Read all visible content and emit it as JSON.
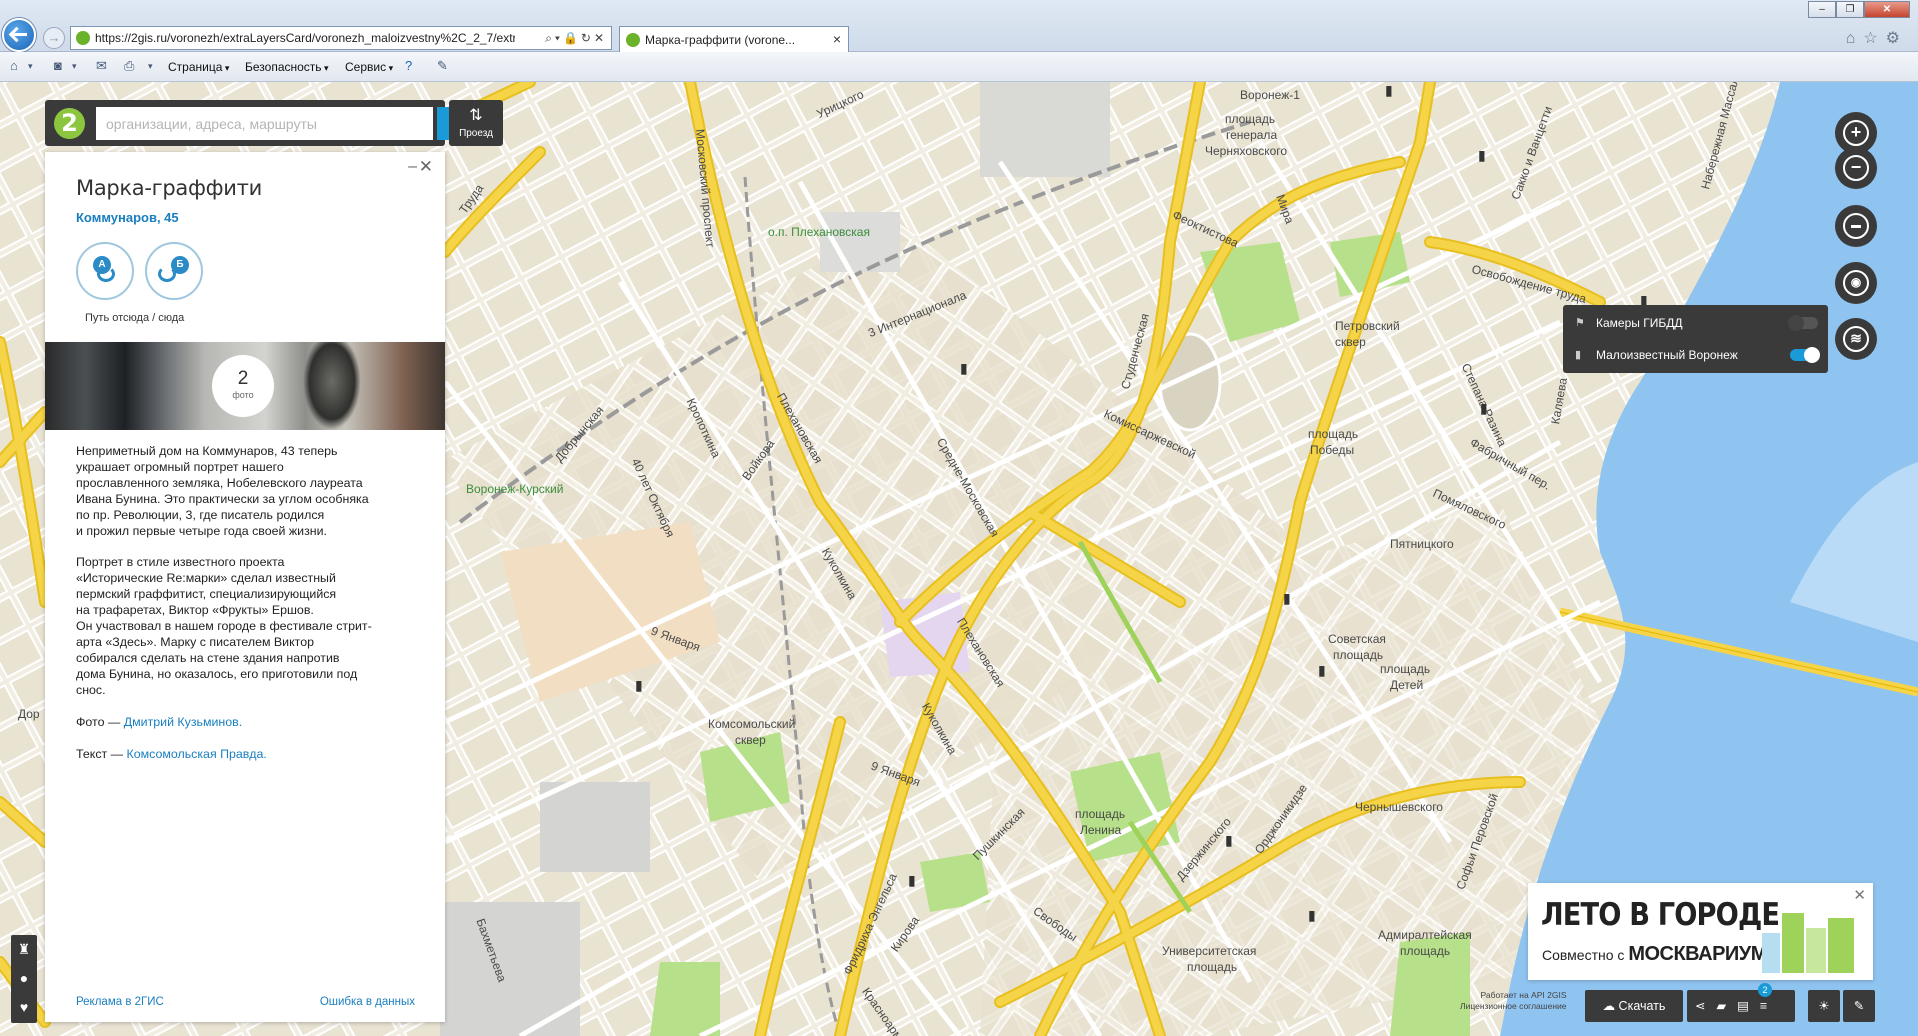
{
  "browser": {
    "url": "https://2gis.ru/voronezh/extraLayersCard/voronezh_maloizvestny%2C_2_7/extraLayer",
    "tab_title": "Марка-граффити (vorone...",
    "toolbar": {
      "page_label": "Страница",
      "security_label": "Безопасность",
      "service_label": "Сервис"
    }
  },
  "search": {
    "placeholder": "организации, адреса, маршруты",
    "route_label": "Проезд"
  },
  "card": {
    "title": "Марка-граффити",
    "address": "Коммунаров, 45",
    "route_from_letter": "А",
    "route_to_letter": "Б",
    "route_caption": "Путь отсюда / сюда",
    "photo_count": "2",
    "photo_count_label": "фото",
    "paragraph_1": "Неприметный дом на Коммунаров, 43 теперь\nукрашает огромный портрет нашего\nпрославленного земляка, Нобелевского лауреата\nИвана Бунина. Это практически за углом особняка\nпо пр. Революции, 3, где писатель родился\nи прожил первые четыре года своей жизни.",
    "paragraph_2": "Портрет в стиле известного проекта\n«Исторические Re:марки» сделал известный\nпермский граффитист, специализирующийся\nна трафаретах, Виктор «Фрукты» Ершов.\nОн участвовал в нашем городе в фестивале стрит-\nарта «Здесь». Марку с писателем Виктор\nсобирался сделать на стене здания напротив\nдома Бунина, но оказалось, его приготовили под\nснос.",
    "photo_credit_prefix": "Фото — ",
    "photo_credit_link": "Дмитрий Кузьминов.",
    "text_credit_prefix": "Текст — ",
    "text_credit_link": "Комсомольская Правда.",
    "footer_ad": "Реклама в 2ГИС",
    "footer_error": "Ошибка в данных"
  },
  "layers": {
    "items": [
      {
        "label": "Камеры ГИБДД",
        "on": false
      },
      {
        "label": "Малоизвестный Воронеж",
        "on": true
      }
    ]
  },
  "promo": {
    "title": "ЛЕТО В ГОРОДЕ",
    "subtitle_prefix": "Совместно с",
    "brand": "МОСКВАРИУМ"
  },
  "bottom": {
    "download_label": "Скачать",
    "credit_line1": "Работает на API 2GIS",
    "credit_line2": "Лицензионное соглашение",
    "badge": "2"
  },
  "map_labels": [
    {
      "text": "Урицкого"
    },
    {
      "text": "Московский проспект"
    },
    {
      "text": "Воронеж-1"
    },
    {
      "text": "площадь"
    },
    {
      "text": "генерала"
    },
    {
      "text": "Черняховского"
    },
    {
      "text": "о.п. Плехановская"
    },
    {
      "text": "Феоктистова"
    },
    {
      "text": "Мира"
    },
    {
      "text": "Освобождение труда"
    },
    {
      "text": "Петровский"
    },
    {
      "text": "сквер"
    },
    {
      "text": "3 Интернационала"
    },
    {
      "text": "Студенческая"
    },
    {
      "text": "Комиссаржевской"
    },
    {
      "text": "Добрынская"
    },
    {
      "text": "Кропоткина"
    },
    {
      "text": "Плехановская"
    },
    {
      "text": "Воронеж-Курский"
    },
    {
      "text": "40 лет Октября"
    },
    {
      "text": "Войкова"
    },
    {
      "text": "Средне-Московская"
    },
    {
      "text": "площадь"
    },
    {
      "text": "Победы"
    },
    {
      "text": "Фабричный пер."
    },
    {
      "text": "Помяловского"
    },
    {
      "text": "Пятницкого"
    },
    {
      "text": "Куколкина"
    },
    {
      "text": "9 Января"
    },
    {
      "text": "Плехановская"
    },
    {
      "text": "Советская"
    },
    {
      "text": "площадь"
    },
    {
      "text": "площадь"
    },
    {
      "text": "Детей"
    },
    {
      "text": "Комсомольский"
    },
    {
      "text": "сквер"
    },
    {
      "text": "9 Января"
    },
    {
      "text": "Куколкина"
    },
    {
      "text": "Пушкинская"
    },
    {
      "text": "Чернышевского"
    },
    {
      "text": "площадь"
    },
    {
      "text": "Ленина"
    },
    {
      "text": "Дзержинского"
    },
    {
      "text": "Орджоникидзе"
    },
    {
      "text": "Фридриха Энгельса"
    },
    {
      "text": "Кирова"
    },
    {
      "text": "Свободы"
    },
    {
      "text": "Университетская"
    },
    {
      "text": "площадь"
    },
    {
      "text": "Адмиралтейская"
    },
    {
      "text": "площадь"
    },
    {
      "text": "Бахметьева"
    },
    {
      "text": "Красноармейская"
    },
    {
      "text": "Софьи Перовской"
    },
    {
      "text": "Степана Разина"
    },
    {
      "text": "Каляева"
    },
    {
      "text": "Сакко и Ванцетти"
    },
    {
      "text": "Набережная Массалитинова"
    },
    {
      "text": "Труда"
    },
    {
      "text": "Дор"
    }
  ],
  "colors": {
    "accent": "#1a9ad6",
    "panel": "#3a3a3a",
    "logo_green": "#8cc63f",
    "road_yellow": "#f6d447",
    "water": "#8fc3f0",
    "park": "#b7e08a"
  }
}
